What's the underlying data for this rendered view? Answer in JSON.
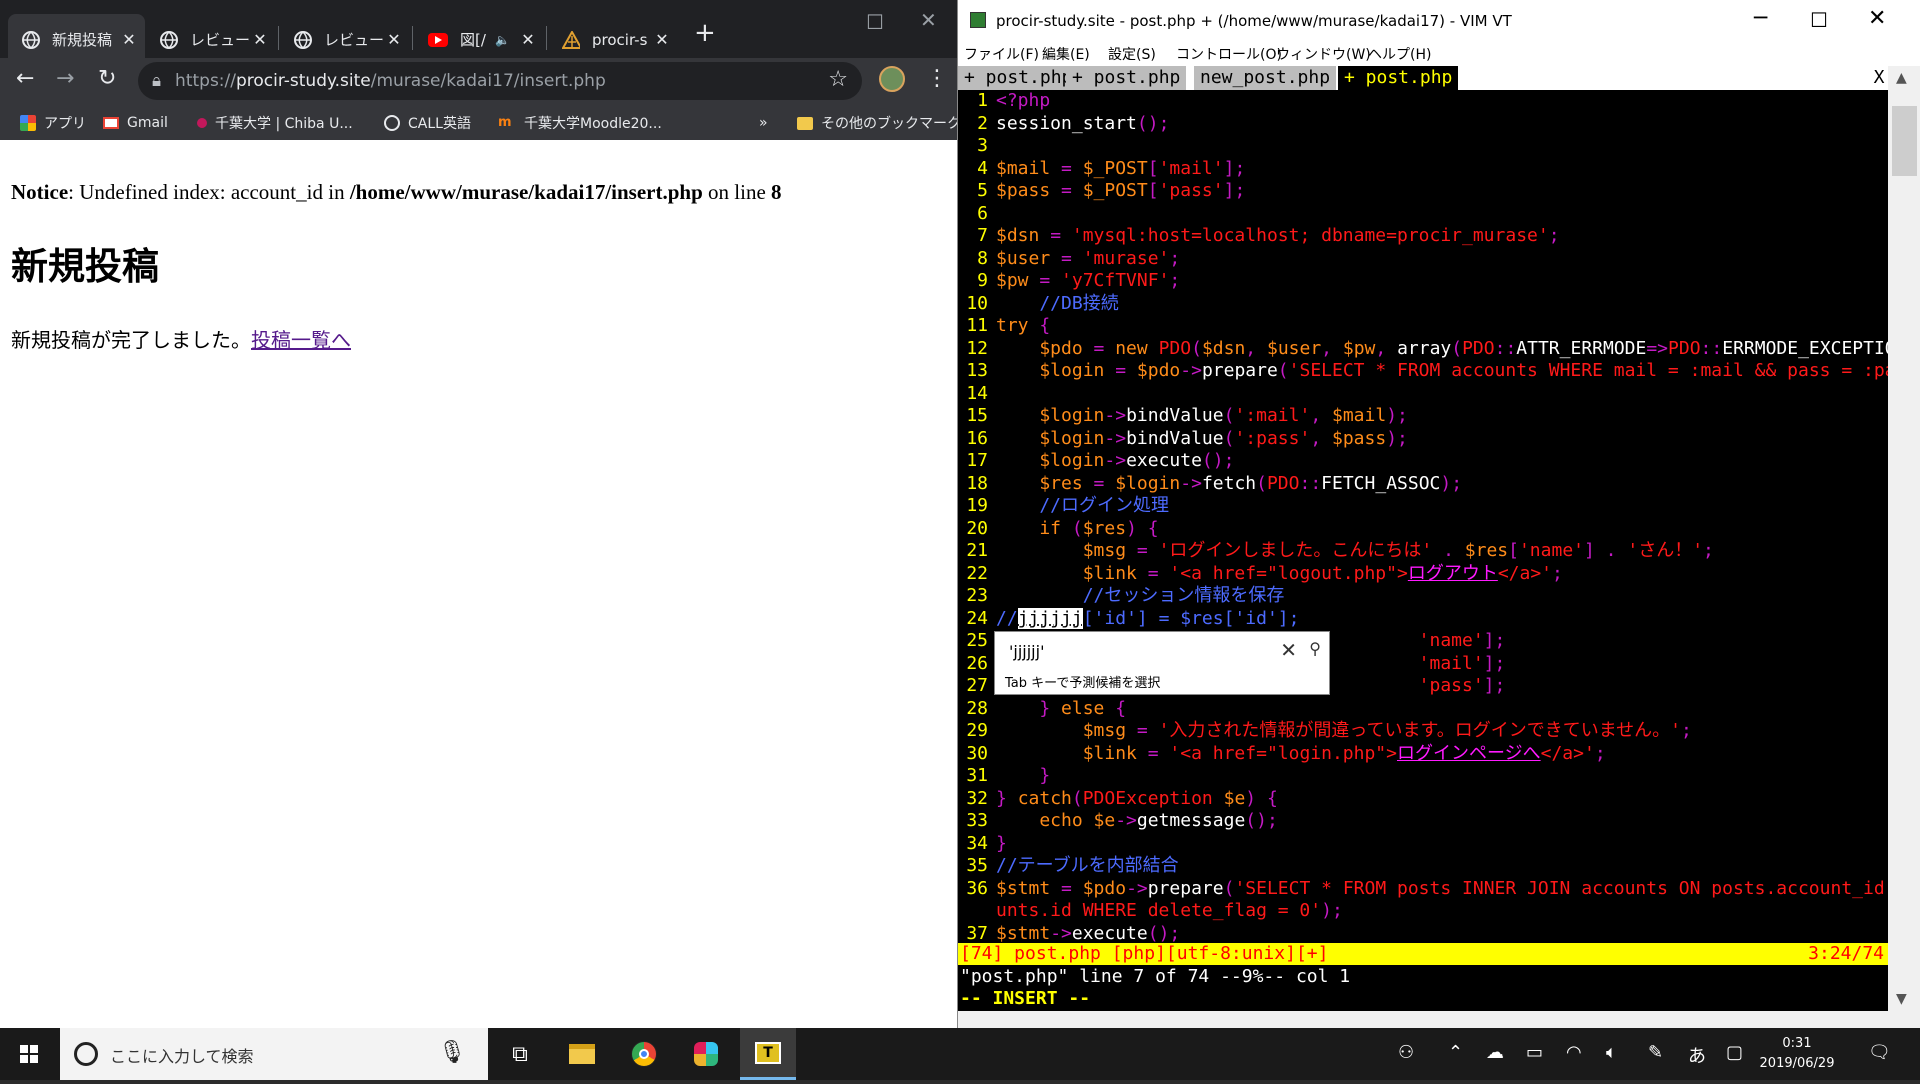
{
  "browser": {
    "tabs": [
      {
        "title": "新規投稿",
        "icon": "globe-icon"
      },
      {
        "title": "レビュー許",
        "icon": "globe-icon"
      },
      {
        "title": "レビュー許",
        "icon": "globe-icon"
      },
      {
        "title": "図[/",
        "icon": "youtube-icon"
      },
      {
        "title": "procir-s",
        "icon": "procir-icon"
      }
    ],
    "url_scheme": "https://",
    "url_host": "procir-study.site",
    "url_path": "/murase/kadai17/insert.php",
    "bookmarks": [
      {
        "label": "アプリ",
        "icon": "apps-icon"
      },
      {
        "label": "Gmail",
        "icon": "gmail-icon"
      },
      {
        "label": "千葉大学 | Chiba U...",
        "icon": "chiba-icon"
      },
      {
        "label": "CALL英語",
        "icon": "globe-icon"
      },
      {
        "label": "千葉大学Moodle20...",
        "icon": "moodle-icon"
      },
      {
        "label": "»",
        "icon": ""
      },
      {
        "label": "その他のブックマーク",
        "icon": "folder-icon"
      }
    ]
  },
  "page": {
    "notice_label": "Notice",
    "notice_text": ": Undefined index: account_id in ",
    "notice_path": "/home/www/murase/kadai17/insert.php",
    "notice_on": " on line ",
    "notice_line": "8",
    "heading": "新規投稿",
    "done_text": "新規投稿が完了しました。",
    "done_link": "投稿一覧へ"
  },
  "vim": {
    "title": "procir-study.site - post.php + (/home/www/murase/kadai17) - VIM VT",
    "menu": [
      "ファイル(F)",
      "編集(E)",
      "設定(S)",
      "コントロール(O)",
      "ウィンドウ(W)",
      "ヘルプ(H)"
    ],
    "tabs": [
      "+ post.php",
      "+ post.php",
      "new_post.php",
      "+ post.php"
    ],
    "tab_close": "X",
    "ime_candidate": "'jjjjjj'",
    "ime_hint": "Tab キーで予測候補を選択",
    "status_left": "[74] post.php [php][utf-8:unix][+]",
    "status_right": "3:24/74",
    "message": "\"post.php\" line 7 of 74 --9%-- col 1",
    "mode": "-- INSERT --",
    "lines": [
      [
        [
          "1",
          "num"
        ],
        [
          "<?php",
          "c-op"
        ]
      ],
      [
        [
          "2",
          "num"
        ],
        [
          "session_start",
          "c-fn"
        ],
        [
          "();",
          "c-op"
        ]
      ],
      [
        [
          "3",
          "num"
        ]
      ],
      [
        [
          "4",
          "num"
        ],
        [
          "$mail",
          "c-var"
        ],
        [
          " = ",
          "c-op"
        ],
        [
          "$_POST",
          "c-var"
        ],
        [
          "[",
          "c-op"
        ],
        [
          "'mail'",
          "c-str"
        ],
        [
          "];",
          "c-op"
        ]
      ],
      [
        [
          "5",
          "num"
        ],
        [
          "$pass",
          "c-var"
        ],
        [
          " = ",
          "c-op"
        ],
        [
          "$_POST",
          "c-var"
        ],
        [
          "[",
          "c-op"
        ],
        [
          "'pass'",
          "c-str"
        ],
        [
          "];",
          "c-op"
        ]
      ],
      [
        [
          "6",
          "num"
        ]
      ],
      [
        [
          "7",
          "num"
        ],
        [
          "$dsn",
          "c-var"
        ],
        [
          " = ",
          "c-op"
        ],
        [
          "'mysql:host=localhost; dbname=procir_murase'",
          "c-str"
        ],
        [
          ";",
          "c-op"
        ]
      ],
      [
        [
          "8",
          "num"
        ],
        [
          "$user",
          "c-var"
        ],
        [
          " = ",
          "c-op"
        ],
        [
          "'murase'",
          "c-str"
        ],
        [
          ";",
          "c-op"
        ]
      ],
      [
        [
          "9",
          "num"
        ],
        [
          "$pw",
          "c-var"
        ],
        [
          " = ",
          "c-op"
        ],
        [
          "'y7CfTVNF'",
          "c-str"
        ],
        [
          ";",
          "c-op"
        ]
      ],
      [
        [
          "10",
          "num"
        ],
        [
          "    //DB接続",
          "c-cmt"
        ]
      ],
      [
        [
          "11",
          "num"
        ],
        [
          "try",
          "c-kw"
        ],
        [
          " {",
          "c-op"
        ]
      ],
      [
        [
          "12",
          "num"
        ],
        [
          "    $pdo",
          "c-var"
        ],
        [
          " = ",
          "c-op"
        ],
        [
          "new",
          "c-kw"
        ],
        [
          " PDO",
          "c-cls"
        ],
        [
          "(",
          "c-op"
        ],
        [
          "$dsn",
          "c-var"
        ],
        [
          ", ",
          "c-op"
        ],
        [
          "$user",
          "c-var"
        ],
        [
          ", ",
          "c-op"
        ],
        [
          "$pw",
          "c-var"
        ],
        [
          ", ",
          "c-op"
        ],
        [
          "array",
          "c-fn"
        ],
        [
          "(",
          "c-op"
        ],
        [
          "PDO",
          "c-cls"
        ],
        [
          "::",
          "c-op"
        ],
        [
          "ATTR_ERRMODE",
          "c-const"
        ],
        [
          "=>",
          "c-op"
        ],
        [
          "PDO",
          "c-cls"
        ],
        [
          "::",
          "c-op"
        ],
        [
          "ERRMODE_EXCEPTION",
          "c-const"
        ],
        [
          "));",
          "c-op"
        ]
      ],
      [
        [
          "13",
          "num"
        ],
        [
          "    $login",
          "c-var"
        ],
        [
          " = ",
          "c-op"
        ],
        [
          "$pdo",
          "c-var"
        ],
        [
          "->",
          "c-op"
        ],
        [
          "prepare",
          "c-fn"
        ],
        [
          "(",
          "c-op"
        ],
        [
          "'SELECT * FROM accounts WHERE mail = :mail && pass = :pass'",
          "c-str"
        ],
        [
          ");",
          "c-op"
        ]
      ],
      [
        [
          "14",
          "num"
        ]
      ],
      [
        [
          "15",
          "num"
        ],
        [
          "    $login",
          "c-var"
        ],
        [
          "->",
          "c-op"
        ],
        [
          "bindValue",
          "c-fn"
        ],
        [
          "(",
          "c-op"
        ],
        [
          "':mail'",
          "c-str"
        ],
        [
          ", ",
          "c-op"
        ],
        [
          "$mail",
          "c-var"
        ],
        [
          ");",
          "c-op"
        ]
      ],
      [
        [
          "16",
          "num"
        ],
        [
          "    $login",
          "c-var"
        ],
        [
          "->",
          "c-op"
        ],
        [
          "bindValue",
          "c-fn"
        ],
        [
          "(",
          "c-op"
        ],
        [
          "':pass'",
          "c-str"
        ],
        [
          ", ",
          "c-op"
        ],
        [
          "$pass",
          "c-var"
        ],
        [
          ");",
          "c-op"
        ]
      ],
      [
        [
          "17",
          "num"
        ],
        [
          "    $login",
          "c-var"
        ],
        [
          "->",
          "c-op"
        ],
        [
          "execute",
          "c-fn"
        ],
        [
          "();",
          "c-op"
        ]
      ],
      [
        [
          "18",
          "num"
        ],
        [
          "    $res",
          "c-var"
        ],
        [
          " = ",
          "c-op"
        ],
        [
          "$login",
          "c-var"
        ],
        [
          "->",
          "c-op"
        ],
        [
          "fetch",
          "c-fn"
        ],
        [
          "(",
          "c-op"
        ],
        [
          "PDO",
          "c-cls"
        ],
        [
          "::",
          "c-op"
        ],
        [
          "FETCH_ASSOC",
          "c-const"
        ],
        [
          ");",
          "c-op"
        ]
      ],
      [
        [
          "19",
          "num"
        ],
        [
          "    //ログイン処理",
          "c-cmt"
        ]
      ],
      [
        [
          "20",
          "num"
        ],
        [
          "    if",
          "c-kw"
        ],
        [
          " (",
          "c-op"
        ],
        [
          "$res",
          "c-var"
        ],
        [
          ") {",
          "c-op"
        ]
      ],
      [
        [
          "21",
          "num"
        ],
        [
          "        $msg",
          "c-var"
        ],
        [
          " = ",
          "c-op"
        ],
        [
          "'ログインしました。こんにちは'",
          "c-str"
        ],
        [
          " . ",
          "c-op"
        ],
        [
          "$res",
          "c-var"
        ],
        [
          "[",
          "c-op"
        ],
        [
          "'name'",
          "c-str"
        ],
        [
          "] . ",
          "c-op"
        ],
        [
          "'さん！'",
          "c-str"
        ],
        [
          ";",
          "c-op"
        ]
      ],
      [
        [
          "22",
          "num"
        ],
        [
          "        $link",
          "c-var"
        ],
        [
          " = ",
          "c-op"
        ],
        [
          "'<a href=\"logout.php\">",
          "c-str"
        ],
        [
          "ログアウト",
          "c-link"
        ],
        [
          "</a>'",
          "c-str"
        ],
        [
          ";",
          "c-op"
        ]
      ],
      [
        [
          "23",
          "num"
        ],
        [
          "        //セッション情報を保存",
          "c-cmt"
        ]
      ],
      [
        [
          "24",
          "num"
        ],
        [
          "//",
          "c-cmt"
        ],
        [
          "jjjjjj",
          "c-def"
        ],
        [
          "['id'] = $res['id'];",
          "c-cmt"
        ]
      ],
      [
        [
          "25",
          "num"
        ],
        [
          "                                       'name'",
          "c-str"
        ],
        [
          "];",
          "c-op"
        ]
      ],
      [
        [
          "26",
          "num"
        ],
        [
          "                                       'mail'",
          "c-str"
        ],
        [
          "];",
          "c-op"
        ]
      ],
      [
        [
          "27",
          "num"
        ],
        [
          "                                       'pass'",
          "c-str"
        ],
        [
          "];",
          "c-op"
        ]
      ],
      [
        [
          "28",
          "num"
        ],
        [
          "    } ",
          "c-op"
        ],
        [
          "else",
          "c-kw"
        ],
        [
          " {",
          "c-op"
        ]
      ],
      [
        [
          "29",
          "num"
        ],
        [
          "        $msg",
          "c-var"
        ],
        [
          " = ",
          "c-op"
        ],
        [
          "'入力された情報が間違っています。ログインできていません。'",
          "c-str"
        ],
        [
          ";",
          "c-op"
        ]
      ],
      [
        [
          "30",
          "num"
        ],
        [
          "        $link",
          "c-var"
        ],
        [
          " = ",
          "c-op"
        ],
        [
          "'<a href=\"login.php\">",
          "c-str"
        ],
        [
          "ログインページへ",
          "c-link"
        ],
        [
          "</a>'",
          "c-str"
        ],
        [
          ";",
          "c-op"
        ]
      ],
      [
        [
          "31",
          "num"
        ],
        [
          "    }",
          "c-op"
        ]
      ],
      [
        [
          "32",
          "num"
        ],
        [
          "} ",
          "c-op"
        ],
        [
          "catch",
          "c-kw"
        ],
        [
          "(",
          "c-op"
        ],
        [
          "PDOException",
          "c-cls"
        ],
        [
          " $e",
          "c-var"
        ],
        [
          ") {",
          "c-op"
        ]
      ],
      [
        [
          "33",
          "num"
        ],
        [
          "    echo",
          "c-kw"
        ],
        [
          " $e",
          "c-var"
        ],
        [
          "->",
          "c-op"
        ],
        [
          "getmessage",
          "c-fn"
        ],
        [
          "();",
          "c-op"
        ]
      ],
      [
        [
          "34",
          "num"
        ],
        [
          "}",
          "c-op"
        ]
      ],
      [
        [
          "35",
          "num"
        ],
        [
          "//テーブルを内部結合",
          "c-cmt"
        ]
      ],
      [
        [
          "36",
          "num"
        ],
        [
          "$stmt",
          "c-var"
        ],
        [
          " = ",
          "c-op"
        ],
        [
          "$pdo",
          "c-var"
        ],
        [
          "->",
          "c-op"
        ],
        [
          "prepare",
          "c-fn"
        ],
        [
          "(",
          "c-op"
        ],
        [
          "'SELECT * FROM posts INNER JOIN accounts ON posts.account_id = acco",
          "c-str"
        ]
      ],
      [
        [
          "",
          "num"
        ],
        [
          "unts.id WHERE delete_flag = 0'",
          "c-str"
        ],
        [
          ");",
          "c-op"
        ]
      ],
      [
        [
          "37",
          "num"
        ],
        [
          "$stmt",
          "c-var"
        ],
        [
          "->",
          "c-op"
        ],
        [
          "execute",
          "c-fn"
        ],
        [
          "();",
          "c-op"
        ]
      ]
    ]
  },
  "taskbar": {
    "search_placeholder": "ここに入力して検索",
    "time": "0:31",
    "date": "2019/06/29",
    "ime_mode": "あ"
  }
}
